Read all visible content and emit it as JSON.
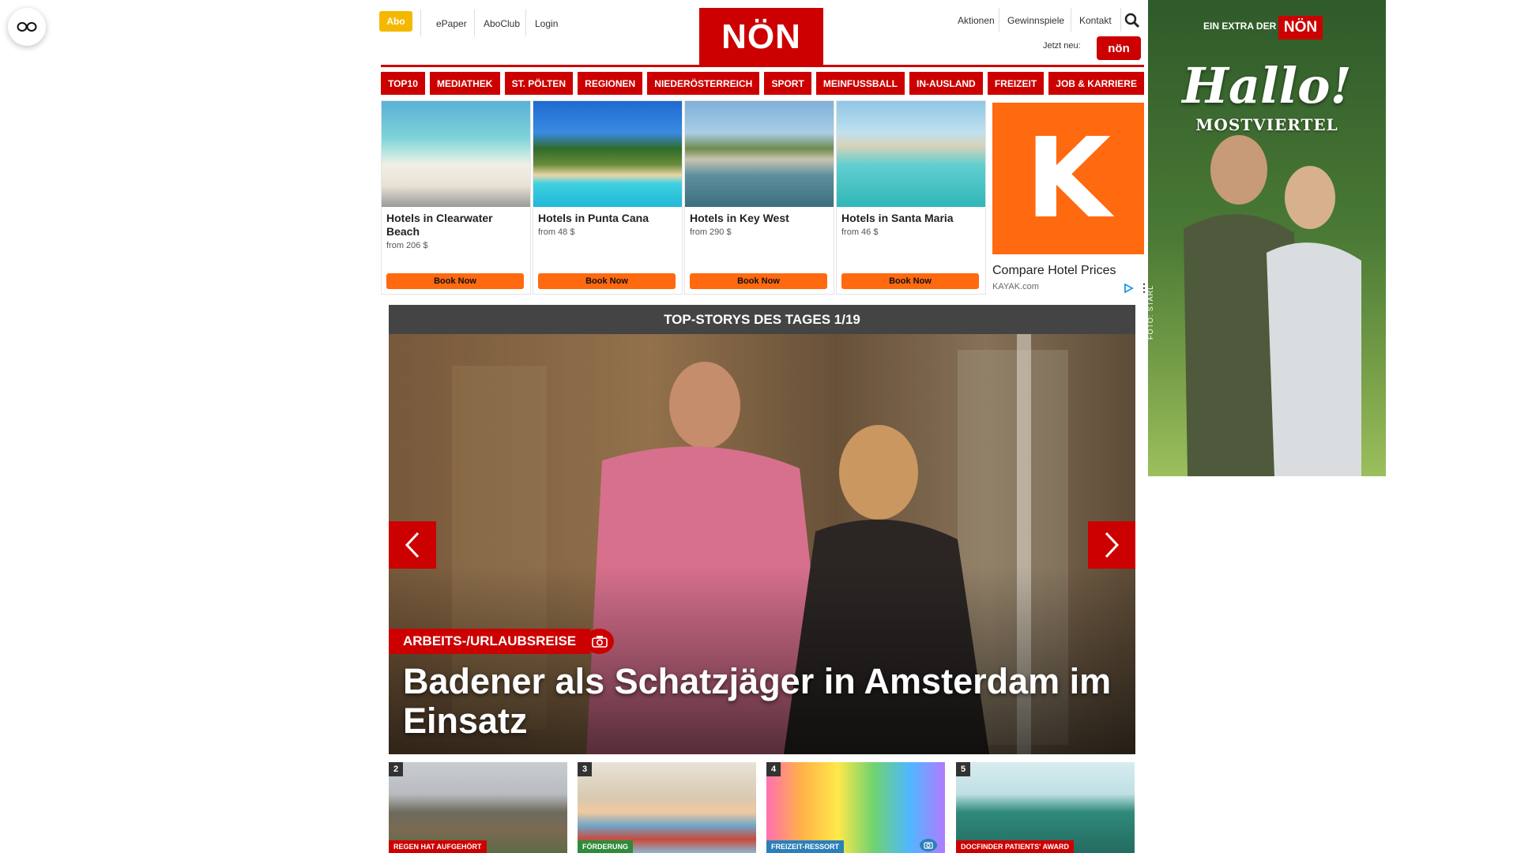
{
  "header": {
    "abo": "Abo",
    "left_links": [
      "ePaper",
      "AboClub",
      "Login"
    ],
    "logo": "NÖN",
    "right_links": [
      "Aktionen",
      "Gewinnspiele",
      "Kontakt"
    ],
    "jetzt_neu": "Jetzt neu:",
    "mini_logo": "nön"
  },
  "nav": [
    "TOP10",
    "MEDIATHEK",
    "ST. PÖLTEN",
    "REGIONEN",
    "NIEDERÖSTERREICH",
    "SPORT",
    "MEINFUSSBALL",
    "IN-AUSLAND",
    "FREIZEIT",
    "JOB & KARRIERE"
  ],
  "hotel_ad": {
    "cards": [
      {
        "title": "Hotels in Clearwater Beach",
        "price": "from 206 $",
        "button": "Book Now"
      },
      {
        "title": "Hotels in Punta Cana",
        "price": "from 48 $",
        "button": "Book Now"
      },
      {
        "title": "Hotels in Key West",
        "price": "from 290 $",
        "button": "Book Now"
      },
      {
        "title": "Hotels in Santa Maria",
        "price": "from 46 $",
        "button": "Book Now"
      }
    ],
    "kayak_letter": "K",
    "kayak_title": "Compare Hotel Prices",
    "kayak_url": "KAYAK.com",
    "more": "⋮"
  },
  "top_stories": {
    "header": "TOP-STORYS DES TAGES 1/19",
    "hero": {
      "category": "ARBEITS-/URLAUBSREISE",
      "title": "Badener als Schatzjäger in Amsterdam im Einsatz"
    },
    "thumbs": [
      {
        "num": "2",
        "category": "REGEN HAT AUFGEHÖRT"
      },
      {
        "num": "3",
        "category": "FÖRDERUNG"
      },
      {
        "num": "4",
        "category": "FREIZEIT-RESSORT"
      },
      {
        "num": "5",
        "category": "DOCFINDER PATIENTS' AWARD"
      }
    ]
  },
  "side_ad": {
    "extra": "EIN EXTRA DER",
    "noen": "NÖN",
    "hallo": "Hallo!",
    "region": "MOSTVIERTEL",
    "credit": "FOTO: STARL"
  },
  "colors": {
    "brand_red": "#cc0000",
    "abo_yellow": "#f5b800",
    "kayak_orange": "#ff690f",
    "story_bar": "#444444"
  }
}
